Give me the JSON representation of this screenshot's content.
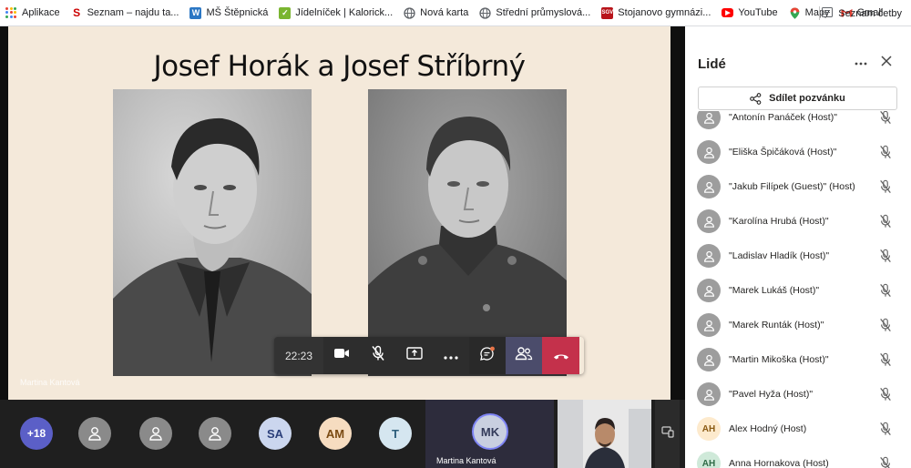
{
  "bookmarks": [
    {
      "label": "Aplikace",
      "icon": "apps-grid-icon"
    },
    {
      "label": "Seznam – najdu ta...",
      "icon": "seznam-icon",
      "color": "#cc0000"
    },
    {
      "label": "MŠ Štěpnická",
      "icon": "w-icon",
      "color": "#2b77c4"
    },
    {
      "label": "Jídelníček | Kalorick...",
      "icon": "kalorick-icon",
      "color": "#7ab530"
    },
    {
      "label": "Nová karta",
      "icon": "globe-icon"
    },
    {
      "label": "Střední průmyslová...",
      "icon": "globe-icon"
    },
    {
      "label": "Stojanovo gymnázi...",
      "icon": "school-icon",
      "color": "#b8141a"
    },
    {
      "label": "YouTube",
      "icon": "youtube-icon",
      "color": "#ff0000"
    },
    {
      "label": "Mapy",
      "icon": "maps-icon"
    },
    {
      "label": "Gmail",
      "icon": "gmail-icon"
    }
  ],
  "reading_list": {
    "label": "Seznam četby",
    "icon": "reading-list-icon"
  },
  "slide": {
    "title": "Josef Horák a Josef Stříbrný",
    "presenter_label": "Martina Kantová"
  },
  "controls": {
    "timer": "22:23",
    "items": [
      "camera-icon",
      "mic-off-icon",
      "share-screen-icon",
      "more-icon",
      "chat-icon",
      "participants-icon",
      "hangup-icon"
    ]
  },
  "strip": {
    "overflow_count": "+18",
    "avatars": [
      {
        "type": "generic"
      },
      {
        "type": "generic"
      },
      {
        "type": "generic"
      },
      {
        "type": "initials",
        "text": "SA",
        "bg": "#cbd6ee",
        "fg": "#2b3f7a"
      },
      {
        "type": "initials",
        "text": "AM",
        "bg": "#f6dcc0",
        "fg": "#7a4a12"
      },
      {
        "type": "initials",
        "text": "T",
        "bg": "#d5e6f0",
        "fg": "#2c5d7a"
      }
    ],
    "active_speaker": {
      "initials": "MK",
      "name": "Martina Kantová"
    }
  },
  "panel": {
    "title": "Lidé",
    "share_label": "Sdílet pozvánku",
    "people": [
      {
        "name": "\"Antonín Panáček (Host)\"",
        "avatar": "generic"
      },
      {
        "name": "\"Eliška Špičáková (Host)\"",
        "avatar": "generic"
      },
      {
        "name": "\"Jakub Filípek (Guest)\" (Host)",
        "avatar": "generic"
      },
      {
        "name": "\"Karolína Hrubá (Host)\"",
        "avatar": "generic"
      },
      {
        "name": "\"Ladislav Hladík (Host)\"",
        "avatar": "generic"
      },
      {
        "name": "\"Marek Lukáš (Host)\"",
        "avatar": "generic"
      },
      {
        "name": "\"Marek Runták (Host)\"",
        "avatar": "generic"
      },
      {
        "name": "\"Martin Mikoška (Host)\"",
        "avatar": "generic"
      },
      {
        "name": "\"Pavel Hyža (Host)\"",
        "avatar": "generic"
      },
      {
        "name": "Alex Hodný (Host)",
        "avatar": "initials",
        "initials": "AH"
      },
      {
        "name": "Anna Hornakova (Host)",
        "avatar": "initials",
        "initials": "AH",
        "tone": "green"
      }
    ]
  }
}
